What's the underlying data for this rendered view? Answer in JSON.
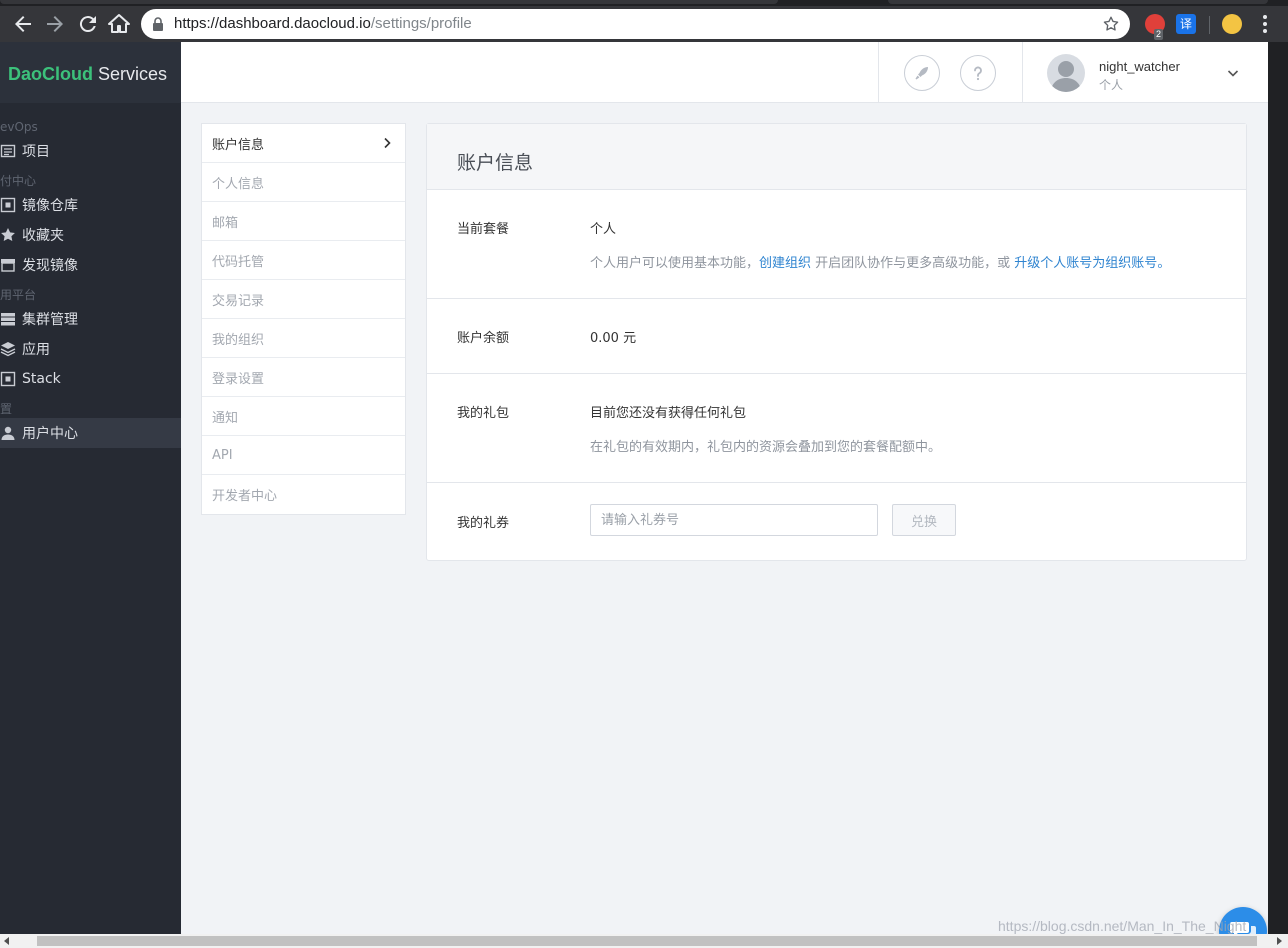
{
  "browser": {
    "url_host": "https://dashboard.daocloud.io",
    "url_path": "/settings/profile",
    "extension_badge": "2",
    "extension_translate": "译"
  },
  "brand": {
    "name_bold": "DaoCloud",
    "name_light": "Services"
  },
  "sidebar": {
    "groups": [
      {
        "label": "evOps",
        "items": [
          {
            "label": "项目",
            "icon": "list-icon"
          }
        ]
      },
      {
        "label": "付中心",
        "items": [
          {
            "label": "镜像仓库",
            "icon": "box-icon"
          },
          {
            "label": "收藏夹",
            "icon": "star-icon"
          },
          {
            "label": "发现镜像",
            "icon": "store-icon"
          }
        ]
      },
      {
        "label": "用平台",
        "items": [
          {
            "label": "集群管理",
            "icon": "server-icon"
          },
          {
            "label": "应用",
            "icon": "layers-icon"
          },
          {
            "label": "Stack",
            "icon": "box-icon"
          }
        ]
      },
      {
        "label": "置",
        "items": [
          {
            "label": "用户中心",
            "icon": "user-icon",
            "active": true
          }
        ]
      }
    ]
  },
  "topbar": {
    "user_name": "night_watcher",
    "user_role": "个人",
    "help_icon": "question-icon",
    "launch_icon": "rocket-icon"
  },
  "subnav": {
    "items": [
      "账户信息",
      "个人信息",
      "邮箱",
      "代码托管",
      "交易记录",
      "我的组织",
      "登录设置",
      "通知",
      "API",
      "开发者中心"
    ],
    "active_index": 0
  },
  "panel": {
    "title": "账户信息",
    "plan": {
      "label": "当前套餐",
      "value": "个人",
      "note_prefix": "个人用户可以使用基本功能，",
      "link_create_org": "创建组织",
      "note_middle": " 开启团队协作与更多高级功能，或 ",
      "link_upgrade": "升级个人账号为组织账号",
      "note_suffix": "。"
    },
    "balance": {
      "label": "账户余额",
      "value": "0.00 元"
    },
    "gift": {
      "label": "我的礼包",
      "value": "目前您还没有获得任何礼包",
      "note": "在礼包的有效期内，礼包内的资源会叠加到您的套餐配额中。"
    },
    "voucher": {
      "label": "我的礼券",
      "placeholder": "请输入礼券号",
      "button": "兑换"
    }
  },
  "watermark": "https://blog.csdn.net/Man_In_The_Night",
  "colors": {
    "brand_green": "#3cc17b",
    "sidebar_bg": "#262a33",
    "link_blue": "#2f84d0",
    "chat_blue": "#2c8de8"
  }
}
